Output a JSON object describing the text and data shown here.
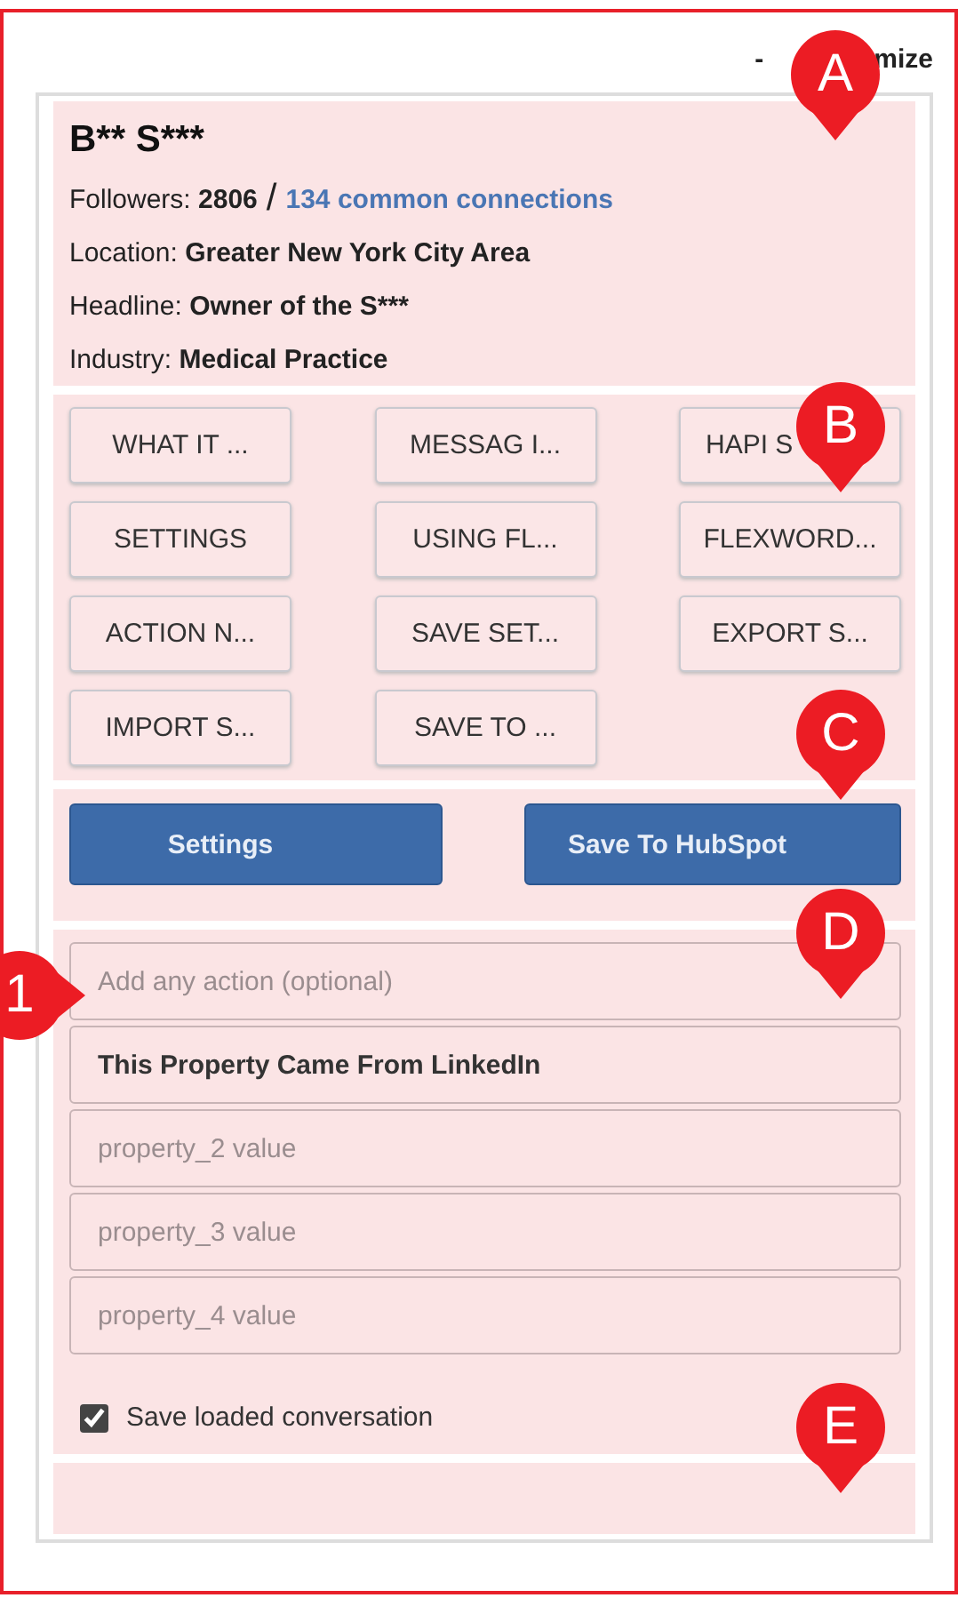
{
  "minimize": {
    "parts": [
      "-",
      "mize"
    ]
  },
  "profile": {
    "name": "B** S***",
    "followers": {
      "label": "Followers:",
      "value": "2806",
      "separator": "/",
      "link": "134 common connections"
    },
    "details": [
      {
        "label": "Location:",
        "value": "Greater New York City Area"
      },
      {
        "label": "Headline:",
        "value": "Owner of the S***"
      },
      {
        "label": "Industry:",
        "value": "Medical Practice"
      }
    ]
  },
  "actions": [
    "WHAT IT ...",
    "MESSAG I...",
    "HAPI S",
    "SETTINGS",
    "USING FL...",
    "FLEXWORD...",
    "ACTION N...",
    "SAVE SET...",
    "EXPORT S...",
    "IMPORT S...",
    "SAVE TO ..."
  ],
  "buttons": [
    "Settings",
    "Save To HubSpot"
  ],
  "fields": [
    {
      "placeholder": "Add any action (optional)"
    },
    {
      "value": "This Property Came From LinkedIn"
    },
    {
      "placeholder": "property_2 value"
    },
    {
      "placeholder": "property_3 value"
    },
    {
      "placeholder": "property_4 value"
    }
  ],
  "save_conversation": {
    "label": "Save loaded conversation",
    "checked": true
  },
  "annotation_markers": [
    {
      "label": "A",
      "kind": "down"
    },
    {
      "label": "B",
      "kind": "down"
    },
    {
      "label": "C",
      "kind": "down"
    },
    {
      "label": "D",
      "kind": "down"
    },
    {
      "label": "E",
      "kind": "down"
    },
    {
      "label": "1",
      "kind": "right"
    }
  ]
}
